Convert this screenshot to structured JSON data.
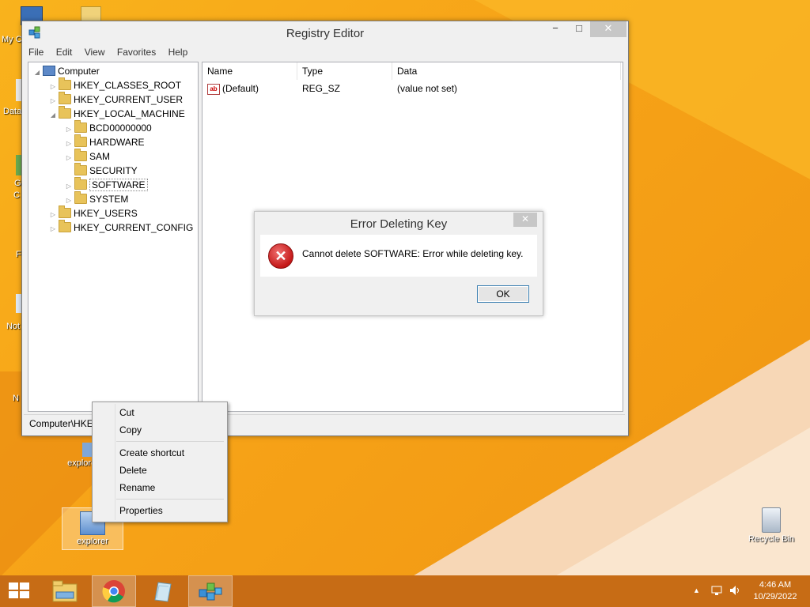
{
  "desktop": {
    "icons": [
      {
        "label": "explorer"
      },
      {
        "label": "explorer"
      },
      {
        "label": "Recycle Bin"
      }
    ],
    "cut_labels": [
      "My C",
      "Data",
      "G",
      "C",
      "F",
      "Not",
      "N"
    ]
  },
  "window": {
    "title": "Registry Editor",
    "controls": {
      "minimize": "−",
      "maximize": "□",
      "close": "✕"
    },
    "menu": [
      "File",
      "Edit",
      "View",
      "Favorites",
      "Help"
    ],
    "tree": {
      "root": "Computer",
      "items": [
        {
          "label": "HKEY_CLASSES_ROOT",
          "expander": "▷"
        },
        {
          "label": "HKEY_CURRENT_USER",
          "expander": "▷"
        },
        {
          "label": "HKEY_LOCAL_MACHINE",
          "expander": "◢"
        },
        {
          "label": "BCD00000000",
          "expander": "▷"
        },
        {
          "label": "HARDWARE",
          "expander": "▷"
        },
        {
          "label": "SAM",
          "expander": "▷"
        },
        {
          "label": "SECURITY",
          "expander": ""
        },
        {
          "label": "SOFTWARE",
          "expander": "▷"
        },
        {
          "label": "SYSTEM",
          "expander": "▷"
        },
        {
          "label": "HKEY_USERS",
          "expander": "▷"
        },
        {
          "label": "HKEY_CURRENT_CONFIG",
          "expander": "▷"
        }
      ]
    },
    "values": {
      "columns": [
        "Name",
        "Type",
        "Data"
      ],
      "rows": [
        {
          "name": "(Default)",
          "type": "REG_SZ",
          "data": "(value not set)",
          "icon_text": "ab"
        }
      ]
    },
    "status": "Computer\\HKE"
  },
  "dialog": {
    "title": "Error Deleting Key",
    "close": "✕",
    "message": "Cannot delete SOFTWARE:  Error while deleting key.",
    "ok": "OK"
  },
  "context_menu": {
    "items": [
      "Cut",
      "Copy",
      "Create shortcut",
      "Delete",
      "Rename",
      "Properties"
    ]
  },
  "taskbar": {
    "time": "4:46 AM",
    "date": "10/29/2022",
    "tray_chevron": "▲"
  }
}
